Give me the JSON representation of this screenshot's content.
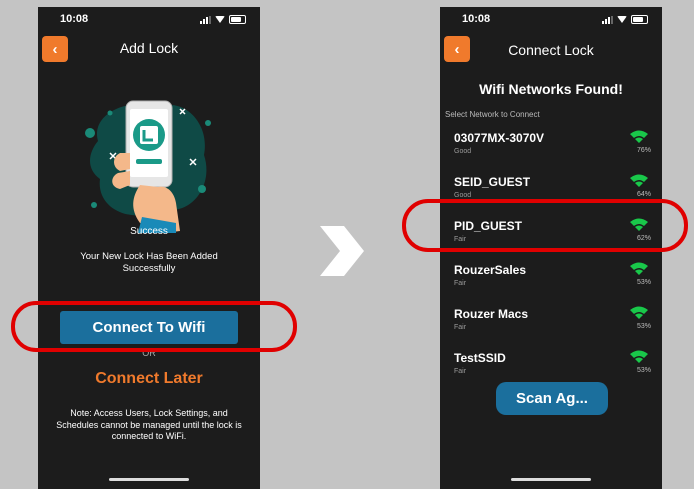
{
  "left_screen": {
    "time": "10:08",
    "title": "Add Lock",
    "success_title": "Success",
    "success_message": "Your New Lock Has Been Added Successfully",
    "connect_button_label": "Connect To Wifi",
    "or_label": "OR",
    "connect_later_label": "Connect Later",
    "note": "Note: Access Users, Lock Settings, and Schedules cannot be managed until the lock is connected to WiFi."
  },
  "right_screen": {
    "time": "10:08",
    "title": "Connect Lock",
    "heading": "Wifi Networks Found!",
    "select_label": "Select Network to Connect",
    "networks": [
      {
        "name": "03077MX-3070V",
        "quality": "Good",
        "strength": "76%"
      },
      {
        "name": "SEID_GUEST",
        "quality": "Good",
        "strength": "64%"
      },
      {
        "name": "PID_GUEST",
        "quality": "Fair",
        "strength": "62%"
      },
      {
        "name": "RouzerSales",
        "quality": "Fair",
        "strength": "53%"
      },
      {
        "name": "Rouzer Macs",
        "quality": "Fair",
        "strength": "53%"
      },
      {
        "name": "TestSSID",
        "quality": "Fair",
        "strength": "53%"
      }
    ],
    "scan_button_label": "Scan Ag..."
  },
  "colors": {
    "accent_orange": "#f07a2c",
    "button_blue": "#1b6f9d",
    "wifi_green": "#19c84a",
    "highlight_red": "#e00000",
    "illustration_teal": "#0f4a46"
  },
  "icons": {
    "back": "chevron-left-icon",
    "wifi": "wifi-icon",
    "flow": "chevron-right-icon"
  }
}
